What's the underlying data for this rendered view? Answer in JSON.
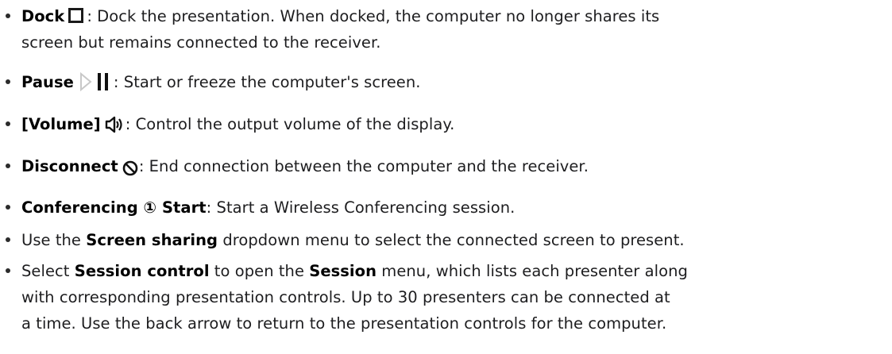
{
  "items": [
    {
      "term": "Dock",
      "icon": "square-dock-icon",
      "desc_line1": ": Dock the presentation. When docked, the computer no longer shares its",
      "desc_line2": "screen but remains connected to the receiver."
    },
    {
      "term": "Pause",
      "icon": "play-pause-icon",
      "desc": ": Start or freeze the computer's screen."
    },
    {
      "term": "[Volume]",
      "icon": "speaker-volume-icon",
      "desc": ": Control the output volume of the display."
    },
    {
      "term": "Disconnect",
      "icon": "prohibited-circle-icon",
      "desc": ": End connection between the computer and the receiver."
    },
    {
      "term": "Conferencing ① Start",
      "desc": ": Start a Wireless Conferencing session."
    },
    {
      "pre": "Use the ",
      "term": "Screen sharing",
      "post": " dropdown menu to select the connected screen to present."
    },
    {
      "pre": "Select ",
      "term": "Session control",
      "mid": " to open the ",
      "term2": "Session",
      "post": " menu, which lists each presenter along",
      "line2": "with corresponding presentation controls. Up to 30 presenters can be connected at",
      "line3": "a time. Use the back arrow to return to the presentation controls for the computer."
    }
  ],
  "colors": {
    "text": "#1d1d1f",
    "bold": "#000000",
    "bullet": "#2b2b2b",
    "pause_triangle": "#c8c8c8"
  }
}
